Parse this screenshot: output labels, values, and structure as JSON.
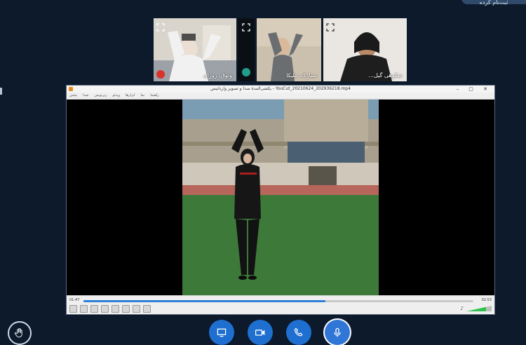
{
  "header": {
    "chip_text": "ثبت‌نام کرده"
  },
  "participants": [
    {
      "name": "وثوق، روژان",
      "active": false
    },
    {
      "name": "سبارک، ملیکا",
      "active": false
    },
    {
      "name": "شکوهی گیل...",
      "active": true
    }
  ],
  "player": {
    "title": "یکشی‌المدة صدا و تصویر وارداتیس - YouCut_20210624_202936218.mp4",
    "menu": [
      "پخش",
      "صدا",
      "زیرنویس",
      "ویدئو",
      "ابزارها",
      "نما",
      "راهنما"
    ],
    "time_elapsed": "01:47",
    "time_total": "02:53",
    "progress_percent": 62,
    "volume_percent": 78
  },
  "toolbar": {
    "buttons": [
      "screen-share",
      "video",
      "phone",
      "microphone"
    ],
    "accent": "#1e6fd0"
  }
}
